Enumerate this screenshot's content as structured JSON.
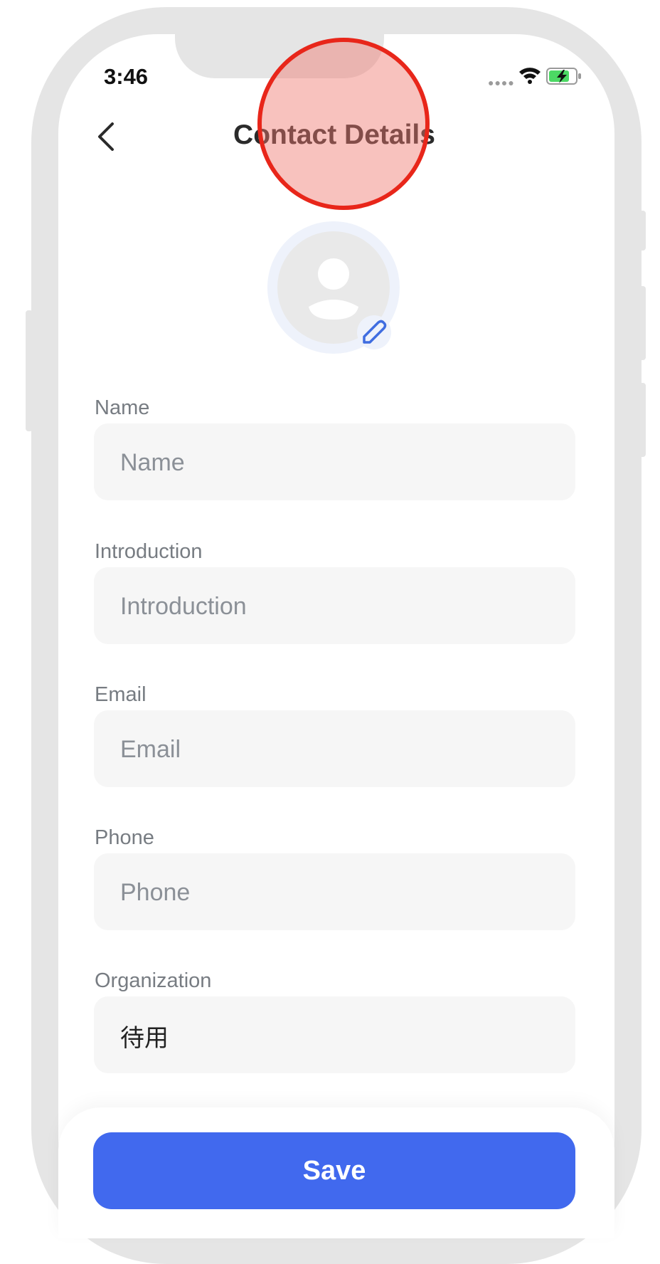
{
  "status_bar": {
    "time": "3:46",
    "signal_icon": "signal-dots",
    "wifi_icon": "wifi-icon",
    "battery_icon": "battery-charging-icon"
  },
  "header": {
    "title": "Contact Details",
    "back_icon": "chevron-left-icon"
  },
  "avatar": {
    "placeholder_icon": "person-icon",
    "edit_icon": "pencil-icon"
  },
  "fields": {
    "name": {
      "label": "Name",
      "placeholder": "Name",
      "value": ""
    },
    "introduction": {
      "label": "Introduction",
      "placeholder": "Introduction",
      "value": ""
    },
    "email": {
      "label": "Email",
      "placeholder": "Email",
      "value": ""
    },
    "phone": {
      "label": "Phone",
      "placeholder": "Phone",
      "value": ""
    },
    "organization": {
      "label": "Organization",
      "placeholder": "",
      "value": "待用"
    }
  },
  "save_label": "Save",
  "colors": {
    "accent": "#4169ee",
    "tap_indicator": "#e8261a",
    "battery": "#4cd964"
  }
}
